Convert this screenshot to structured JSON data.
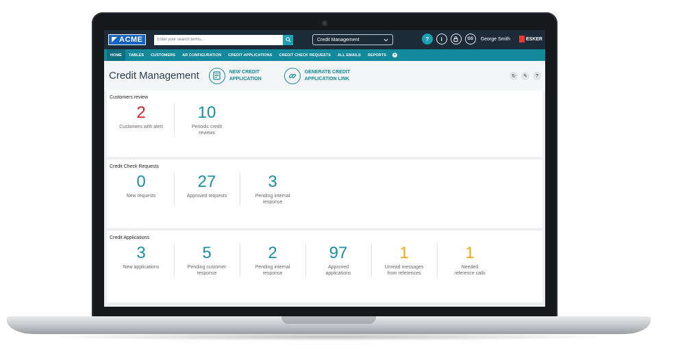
{
  "app": {
    "logo": "ACME",
    "search_placeholder": "Enter your search terms...",
    "module": "Credit Management",
    "user_initials": "GS",
    "user_name": "George Smith",
    "vendor": "ESKER"
  },
  "nav": [
    {
      "label": "HOME",
      "active": true
    },
    {
      "label": "TABLES"
    },
    {
      "label": "CUSTOMERS"
    },
    {
      "label": "AR CONFIGURATION"
    },
    {
      "label": "CREDIT APPLICATIONS"
    },
    {
      "label": "CREDIT CHECK REQUESTS"
    },
    {
      "label": "ALL EMAILS"
    },
    {
      "label": "REPORTS"
    }
  ],
  "header": {
    "title": "Credit Management",
    "action1": {
      "line1": "NEW CREDIT",
      "line2": "APPLICATION"
    },
    "action2": {
      "line1": "GENERATE CREDIT",
      "line2": "APPLICATION LINK"
    }
  },
  "panels": {
    "customers_review": {
      "title": "Customers review",
      "kpis": [
        {
          "value": "2",
          "label": "Customers with alert"
        },
        {
          "value": "10",
          "label": "Periodic credit reviews"
        }
      ]
    },
    "credit_check": {
      "title": "Credit Check Requests",
      "kpis": [
        {
          "value": "0",
          "label": "New requests"
        },
        {
          "value": "27",
          "label": "Approved requests"
        },
        {
          "value": "3",
          "label": "Pending internal response"
        }
      ]
    },
    "credit_apps": {
      "title": "Credit Applications",
      "kpis": [
        {
          "value": "3",
          "label": "New applications"
        },
        {
          "value": "5",
          "label": "Pending customer response"
        },
        {
          "value": "2",
          "label": "Pending internal response"
        },
        {
          "value": "97",
          "label": "Approved applications"
        },
        {
          "value": "1",
          "label": "Unread messages from references"
        },
        {
          "value": "1",
          "label": "Needed reference calls"
        }
      ]
    }
  },
  "colors": {
    "alert": "#d0232a",
    "accent": "#1a8fa2",
    "warning": "#f0a819",
    "topbar": "#1d2b39",
    "nav": "#138a9c"
  }
}
